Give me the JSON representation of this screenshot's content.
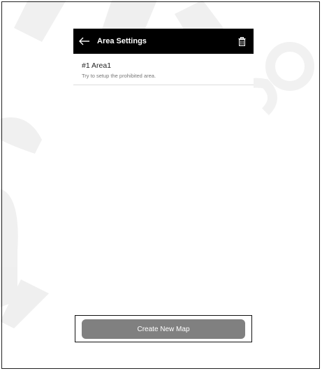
{
  "header": {
    "title": "Area Settings",
    "back_icon": "arrow-left-icon",
    "delete_icon": "trash-icon"
  },
  "areas": [
    {
      "name": "#1 Area1",
      "hint": "Try to setup the prohibited area."
    }
  ],
  "footer": {
    "create_label": "Create New Map"
  },
  "colors": {
    "app_bar": "#000000",
    "button": "#808080",
    "button_text": "#ffffff"
  }
}
